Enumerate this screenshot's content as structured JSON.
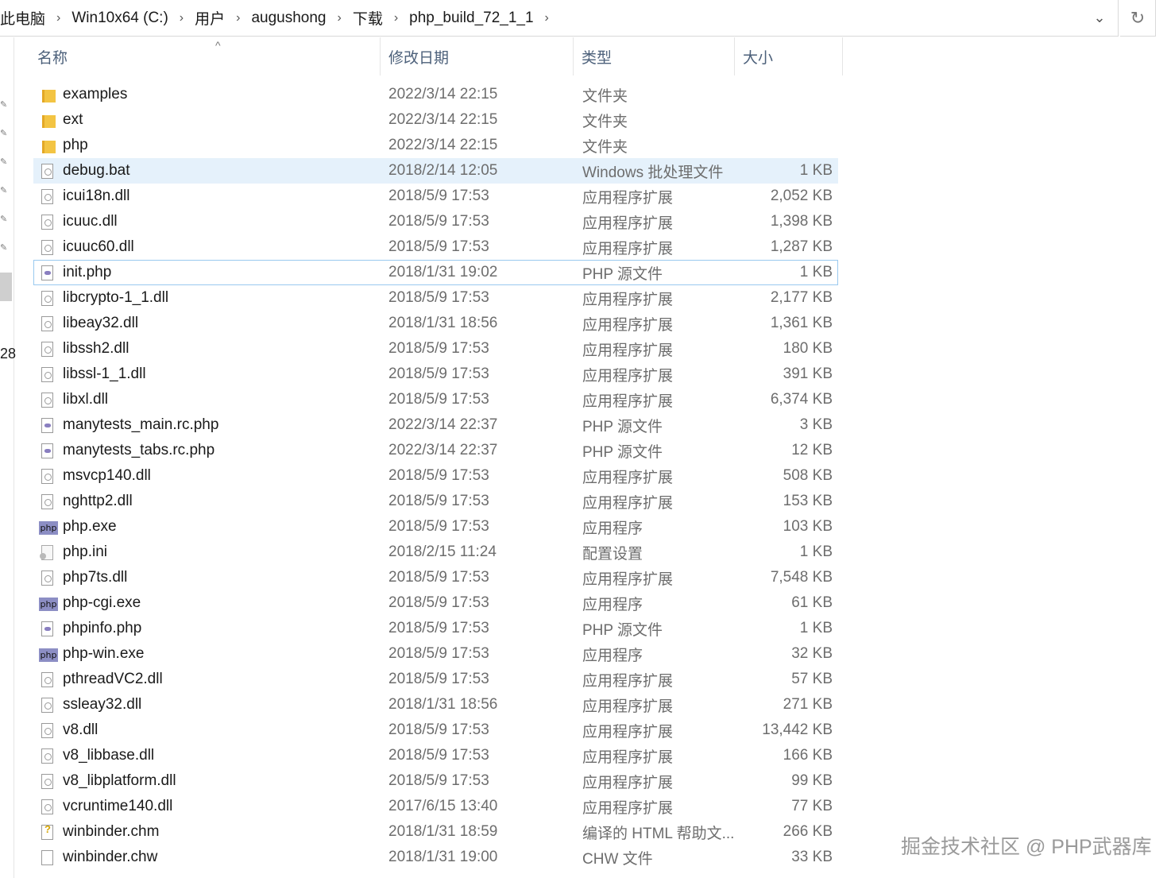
{
  "address": {
    "crumbs": [
      "此电脑",
      "Win10x64 (C:)",
      "用户",
      "augushong",
      "下载",
      "php_build_72_1_1"
    ],
    "separator": "›",
    "dropdown": "⌄",
    "refresh": "↻"
  },
  "nav": {
    "partial_text": "28"
  },
  "columns": {
    "name": "名称",
    "date": "修改日期",
    "type": "类型",
    "size": "大小",
    "sort_indicator": "^"
  },
  "files": [
    {
      "name": "examples",
      "date": "2022/3/14 22:15",
      "type": "文件夹",
      "size": "",
      "icon": "folder-icon"
    },
    {
      "name": "ext",
      "date": "2022/3/14 22:15",
      "type": "文件夹",
      "size": "",
      "icon": "folder-icon"
    },
    {
      "name": "php",
      "date": "2022/3/14 22:15",
      "type": "文件夹",
      "size": "",
      "icon": "folder-icon"
    },
    {
      "name": "debug.bat",
      "date": "2018/2/14 12:05",
      "type": "Windows 批处理文件",
      "size": "1 KB",
      "icon": "batch-file-icon",
      "selected": true
    },
    {
      "name": "icui18n.dll",
      "date": "2018/5/9 17:53",
      "type": "应用程序扩展",
      "size": "2,052 KB",
      "icon": "dll-file-icon"
    },
    {
      "name": "icuuc.dll",
      "date": "2018/5/9 17:53",
      "type": "应用程序扩展",
      "size": "1,398 KB",
      "icon": "dll-file-icon"
    },
    {
      "name": "icuuc60.dll",
      "date": "2018/5/9 17:53",
      "type": "应用程序扩展",
      "size": "1,287 KB",
      "icon": "dll-file-icon"
    },
    {
      "name": "init.php",
      "date": "2018/1/31 19:02",
      "type": "PHP 源文件",
      "size": "1 KB",
      "icon": "php-file-icon",
      "focused": true
    },
    {
      "name": "libcrypto-1_1.dll",
      "date": "2018/5/9 17:53",
      "type": "应用程序扩展",
      "size": "2,177 KB",
      "icon": "dll-file-icon"
    },
    {
      "name": "libeay32.dll",
      "date": "2018/1/31 18:56",
      "type": "应用程序扩展",
      "size": "1,361 KB",
      "icon": "dll-file-icon"
    },
    {
      "name": "libssh2.dll",
      "date": "2018/5/9 17:53",
      "type": "应用程序扩展",
      "size": "180 KB",
      "icon": "dll-file-icon"
    },
    {
      "name": "libssl-1_1.dll",
      "date": "2018/5/9 17:53",
      "type": "应用程序扩展",
      "size": "391 KB",
      "icon": "dll-file-icon"
    },
    {
      "name": "libxl.dll",
      "date": "2018/5/9 17:53",
      "type": "应用程序扩展",
      "size": "6,374 KB",
      "icon": "dll-file-icon"
    },
    {
      "name": "manytests_main.rc.php",
      "date": "2022/3/14 22:37",
      "type": "PHP 源文件",
      "size": "3 KB",
      "icon": "php-file-icon"
    },
    {
      "name": "manytests_tabs.rc.php",
      "date": "2022/3/14 22:37",
      "type": "PHP 源文件",
      "size": "12 KB",
      "icon": "php-file-icon"
    },
    {
      "name": "msvcp140.dll",
      "date": "2018/5/9 17:53",
      "type": "应用程序扩展",
      "size": "508 KB",
      "icon": "dll-file-icon"
    },
    {
      "name": "nghttp2.dll",
      "date": "2018/5/9 17:53",
      "type": "应用程序扩展",
      "size": "153 KB",
      "icon": "dll-file-icon"
    },
    {
      "name": "php.exe",
      "date": "2018/5/9 17:53",
      "type": "应用程序",
      "size": "103 KB",
      "icon": "php-exe-icon"
    },
    {
      "name": "php.ini",
      "date": "2018/2/15 11:24",
      "type": "配置设置",
      "size": "1 KB",
      "icon": "ini-file-icon"
    },
    {
      "name": "php7ts.dll",
      "date": "2018/5/9 17:53",
      "type": "应用程序扩展",
      "size": "7,548 KB",
      "icon": "dll-file-icon"
    },
    {
      "name": "php-cgi.exe",
      "date": "2018/5/9 17:53",
      "type": "应用程序",
      "size": "61 KB",
      "icon": "php-exe-icon"
    },
    {
      "name": "phpinfo.php",
      "date": "2018/5/9 17:53",
      "type": "PHP 源文件",
      "size": "1 KB",
      "icon": "php-file-icon"
    },
    {
      "name": "php-win.exe",
      "date": "2018/5/9 17:53",
      "type": "应用程序",
      "size": "32 KB",
      "icon": "php-exe-icon"
    },
    {
      "name": "pthreadVC2.dll",
      "date": "2018/5/9 17:53",
      "type": "应用程序扩展",
      "size": "57 KB",
      "icon": "dll-file-icon"
    },
    {
      "name": "ssleay32.dll",
      "date": "2018/1/31 18:56",
      "type": "应用程序扩展",
      "size": "271 KB",
      "icon": "dll-file-icon"
    },
    {
      "name": "v8.dll",
      "date": "2018/5/9 17:53",
      "type": "应用程序扩展",
      "size": "13,442 KB",
      "icon": "dll-file-icon"
    },
    {
      "name": "v8_libbase.dll",
      "date": "2018/5/9 17:53",
      "type": "应用程序扩展",
      "size": "166 KB",
      "icon": "dll-file-icon"
    },
    {
      "name": "v8_libplatform.dll",
      "date": "2018/5/9 17:53",
      "type": "应用程序扩展",
      "size": "99 KB",
      "icon": "dll-file-icon"
    },
    {
      "name": "vcruntime140.dll",
      "date": "2017/6/15 13:40",
      "type": "应用程序扩展",
      "size": "77 KB",
      "icon": "dll-file-icon"
    },
    {
      "name": "winbinder.chm",
      "date": "2018/1/31 18:59",
      "type": "编译的 HTML 帮助文...",
      "size": "266 KB",
      "icon": "chm-file-icon"
    },
    {
      "name": "winbinder.chw",
      "date": "2018/1/31 19:00",
      "type": "CHW 文件",
      "size": "33 KB",
      "icon": "blank-file-icon"
    }
  ],
  "exe_icon_text": "php",
  "watermark": "掘金技术社区 @ PHP武器库"
}
